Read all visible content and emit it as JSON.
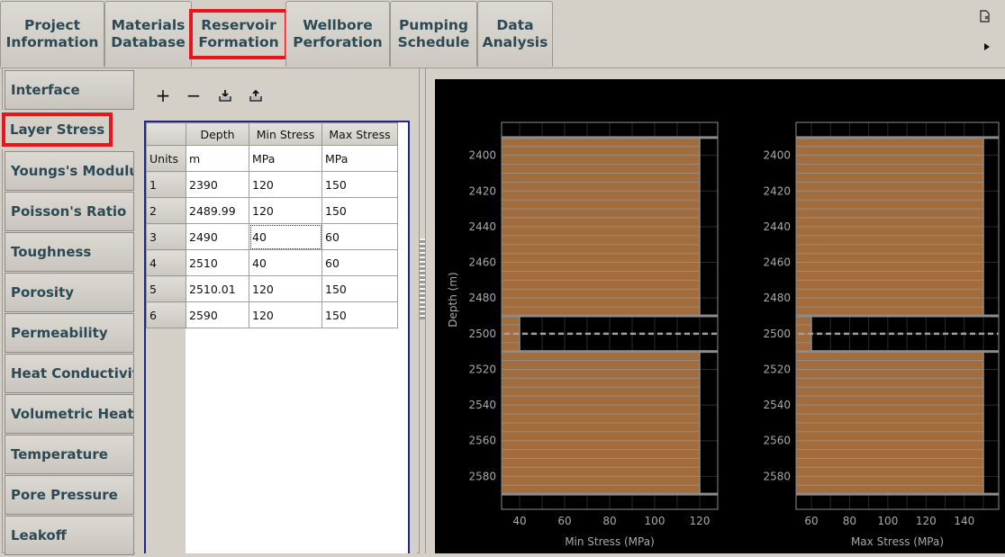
{
  "tabs": [
    {
      "label": "Project\nInformation",
      "active": false
    },
    {
      "label": "Materials\nDatabase",
      "active": false
    },
    {
      "label": "Reservoir\nFormation",
      "active": true
    },
    {
      "label": "Wellbore\nPerforation",
      "active": false
    },
    {
      "label": "Pumping\nSchedule",
      "active": false
    },
    {
      "label": "Data\nAnalysis",
      "active": false
    }
  ],
  "corner_icons": {
    "document": "document-icon",
    "arrow": "arrow-right-icon"
  },
  "sidebar": {
    "items": [
      {
        "label": "Interface"
      },
      {
        "label": "Layer Stress",
        "active": true
      },
      {
        "label": "Youngs's Modulus"
      },
      {
        "label": "Poisson's Ratio"
      },
      {
        "label": "Toughness"
      },
      {
        "label": "Porosity"
      },
      {
        "label": "Permeability"
      },
      {
        "label": "Heat Conductivity"
      },
      {
        "label": "Volumetric Heat Capacity"
      },
      {
        "label": "Temperature"
      },
      {
        "label": "Pore Pressure"
      },
      {
        "label": "Leakoff"
      }
    ]
  },
  "toolbar": {
    "add": "+",
    "remove": "−",
    "import": "⤓",
    "export": "⤒"
  },
  "table": {
    "columns": [
      "Depth",
      "Min Stress",
      "Max Stress"
    ],
    "units_label": "Units",
    "units": [
      "m",
      "MPa",
      "MPa"
    ],
    "rows": [
      {
        "id": "1",
        "cells": [
          "2390",
          "120",
          "150"
        ]
      },
      {
        "id": "2",
        "cells": [
          "2489.99",
          "120",
          "150"
        ]
      },
      {
        "id": "3",
        "cells": [
          "2490",
          "40",
          "60"
        ]
      },
      {
        "id": "4",
        "cells": [
          "2510",
          "40",
          "60"
        ]
      },
      {
        "id": "5",
        "cells": [
          "2510.01",
          "120",
          "150"
        ]
      },
      {
        "id": "6",
        "cells": [
          "2590",
          "120",
          "150"
        ]
      }
    ],
    "selected_cell": {
      "row": 2,
      "col": 1
    }
  },
  "colors": {
    "bar": "#a26c3c",
    "grid": "#2a2a2a",
    "frame": "#8c8c8c",
    "text": "#a8a8a8",
    "highlight": "#e8151f"
  },
  "chart_data": [
    {
      "type": "bar",
      "orientation": "horizontal-step",
      "xlabel": "Min Stress (MPa)",
      "ylabel": "Depth (m)",
      "xlim": [
        32,
        128
      ],
      "ylim": [
        2580,
        2410
      ],
      "ylim_full": [
        2590,
        2390
      ],
      "xticks": [
        40,
        60,
        80,
        100,
        120
      ],
      "yticks": [
        2400,
        2420,
        2440,
        2460,
        2480,
        2500,
        2520,
        2540,
        2560,
        2580
      ],
      "layers": [
        {
          "top": 2390,
          "bottom": 2490,
          "value": 120
        },
        {
          "top": 2490,
          "bottom": 2510,
          "value": 40
        },
        {
          "top": 2510,
          "bottom": 2590,
          "value": 120
        }
      ],
      "reference_depth": 2500,
      "grid": true
    },
    {
      "type": "bar",
      "orientation": "horizontal-step",
      "xlabel": "Max Stress (MPa)",
      "ylabel": "",
      "xlim": [
        52,
        158
      ],
      "xticks": [
        60,
        80,
        100,
        120,
        140
      ],
      "yticks": [
        2400,
        2420,
        2440,
        2460,
        2480,
        2500,
        2520,
        2540,
        2560,
        2580
      ],
      "layers": [
        {
          "top": 2390,
          "bottom": 2490,
          "value": 150
        },
        {
          "top": 2490,
          "bottom": 2510,
          "value": 60
        },
        {
          "top": 2510,
          "bottom": 2590,
          "value": 150
        }
      ],
      "reference_depth": 2500,
      "grid": true
    }
  ]
}
